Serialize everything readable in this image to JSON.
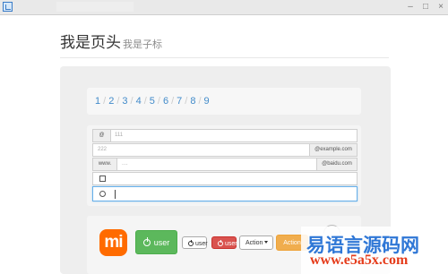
{
  "window": {
    "icon": "window-app-icon",
    "title": "",
    "controls": {
      "minimize": "–",
      "maximize": "□",
      "close": "×"
    }
  },
  "header": {
    "title": "我是页头",
    "subtitle": "我是子标"
  },
  "pagination": {
    "pages": [
      "1",
      "2",
      "3",
      "4",
      "5",
      "6",
      "7",
      "8",
      "9"
    ],
    "separator": "/"
  },
  "form": {
    "row1": {
      "prefix": "@",
      "value": "111"
    },
    "row2": {
      "value": "222",
      "suffix": "@example.com"
    },
    "row3": {
      "prefix": "www.",
      "value": "....",
      "suffix": "@baidu.com"
    },
    "row4": {
      "control": "checkbox",
      "value": ""
    },
    "row5": {
      "control": "radio",
      "value": ""
    }
  },
  "buttons": {
    "mi_logo": "mi",
    "user_large": "user",
    "user_default": "user",
    "user_danger": "user",
    "action_default": "Action",
    "action_warning": "Action"
  },
  "watermark": {
    "main": "易语言源码网",
    "url": "www.e5a5x.com"
  },
  "colors": {
    "link": "#428bca",
    "success": "#5cb85c",
    "danger": "#d9534f",
    "warning": "#f0ad4e",
    "watermark_blue": "#2f77d6",
    "watermark_red": "#e53c1b"
  }
}
